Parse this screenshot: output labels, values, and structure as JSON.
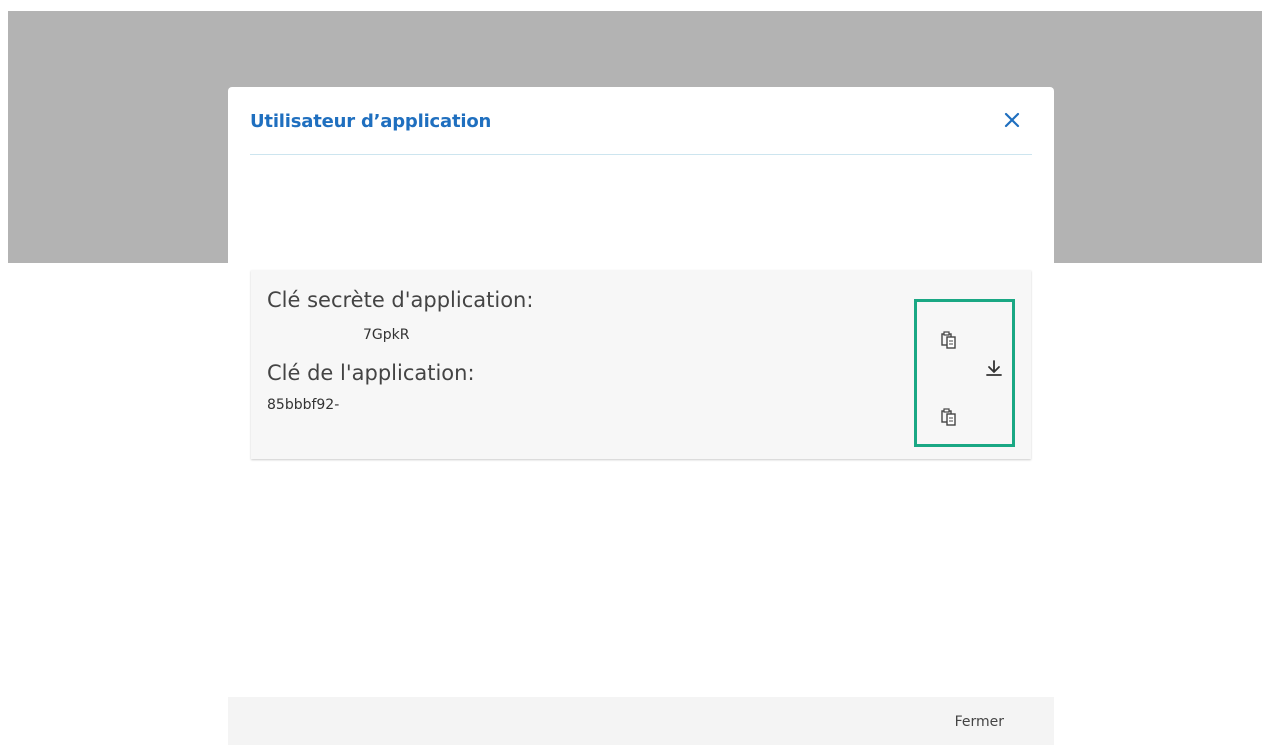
{
  "dialog": {
    "title": "Utilisateur d’application",
    "close_icon": "close-icon"
  },
  "keys": {
    "secret_label": "Clé secrète d'application:",
    "secret_value": "7GpkR",
    "app_label": "Clé de l'application:",
    "app_value": "85bbbf92-",
    "copy_icon": "clipboard-icon",
    "download_icon": "download-icon"
  },
  "footer": {
    "close_label": "Fermer"
  },
  "colors": {
    "title": "#1f6fbf",
    "highlight": "#1aa884",
    "backdrop": "#b3b3b3"
  }
}
